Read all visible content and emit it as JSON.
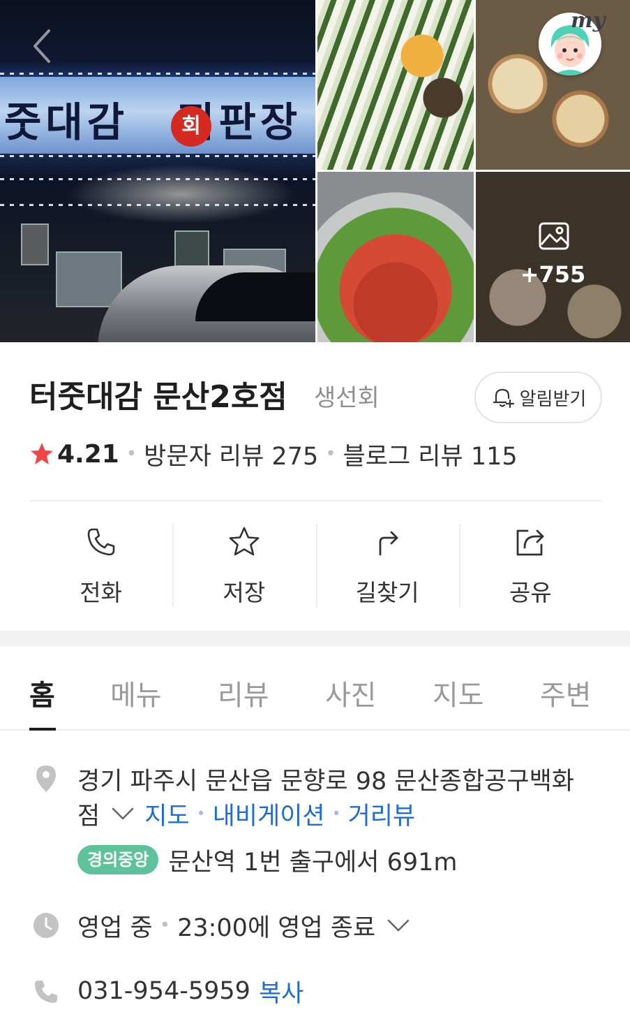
{
  "photos": {
    "main_sign_text": "줏대감",
    "main_sign_badge": "회",
    "main_sign_text2": "직판장",
    "more_count": "+755"
  },
  "my_badge": {
    "label": "my"
  },
  "place": {
    "name": "터줏대감 문산2호점",
    "category": "생선회",
    "notify_label": "알림받기",
    "rating": "4.21",
    "visitor_reviews": "방문자 리뷰 275",
    "blog_reviews": "블로그 리뷰 115"
  },
  "actions": [
    {
      "label": "전화",
      "icon": "phone-icon"
    },
    {
      "label": "저장",
      "icon": "star-outline-icon"
    },
    {
      "label": "길찾기",
      "icon": "directions-icon"
    },
    {
      "label": "공유",
      "icon": "share-icon"
    }
  ],
  "tabs": [
    {
      "label": "홈",
      "active": true
    },
    {
      "label": "메뉴"
    },
    {
      "label": "리뷰"
    },
    {
      "label": "사진"
    },
    {
      "label": "지도"
    },
    {
      "label": "주변"
    }
  ],
  "info": {
    "address_line1": "경기 파주시 문산읍 문향로 98 문산종합공구백화",
    "address_line2": "점",
    "links": [
      "지도",
      "내비게이션",
      "거리뷰"
    ],
    "subway_line": "경의중앙",
    "station_text": "문산역 1번 출구에서 691m",
    "hours_status": "영업 중",
    "hours_detail": "23:00에 영업 종료",
    "phone": "031-954-5959",
    "copy_label": "복사"
  },
  "colors": {
    "accent_blue": "#1e6cd6",
    "star_red": "#f0464a",
    "line_badge_green": "#5ec29a"
  }
}
